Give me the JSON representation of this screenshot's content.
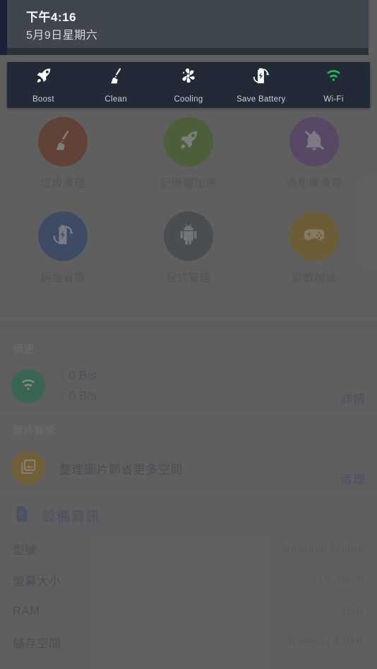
{
  "notification": {
    "time": "下午4:16",
    "date": "5月9日星期六"
  },
  "quick_settings": {
    "items": [
      {
        "icon": "rocket-icon",
        "label": "Boost",
        "color": "#ffffff"
      },
      {
        "icon": "broom-icon",
        "label": "Clean",
        "color": "#ffffff"
      },
      {
        "icon": "fan-icon",
        "label": "Cooling",
        "color": "#ffffff"
      },
      {
        "icon": "battery-bolt-icon",
        "label": "Save Battery",
        "color": "#ffffff"
      },
      {
        "icon": "wifi-icon",
        "label": "Wi-Fi",
        "color": "#22bb55"
      }
    ]
  },
  "features": {
    "items": [
      {
        "icon": "broom-icon",
        "label": "垃圾清理",
        "color": "#6b2409"
      },
      {
        "icon": "rocket-icon",
        "label": "記憶體加速",
        "color": "#3f6712"
      },
      {
        "icon": "bell-off-icon",
        "label": "通知欄清理",
        "color": "#5a3278"
      },
      {
        "icon": "battery-bolt-icon",
        "label": "超強省電",
        "color": "#1c3b78"
      },
      {
        "icon": "android-icon",
        "label": "程式管理",
        "color": "#36414c"
      },
      {
        "icon": "gamepad-icon",
        "label": "遊戲加速",
        "color": "#8a6408"
      }
    ]
  },
  "network": {
    "title": "網速",
    "icon": "wifi-icon",
    "icon_color": "#0c7a4b",
    "download": "↓ 0 B/s",
    "upload": "↑ 0 B/s",
    "action": "詳情"
  },
  "photo_manager": {
    "title": "照片管家",
    "icon": "photo-icon",
    "icon_color": "#94690a",
    "text": "整理圖片節省更多空間",
    "action": "清理"
  },
  "device_info": {
    "icon": "document-icon",
    "title": "設備資訊",
    "rows": [
      {
        "key": "型號",
        "value": "Netease MuMu"
      },
      {
        "key": "螢幕大小",
        "value": "10.3Inch"
      },
      {
        "key": "RAM",
        "value": "3GB"
      },
      {
        "key": "儲存空間",
        "value": "Internal 32GB"
      }
    ]
  }
}
